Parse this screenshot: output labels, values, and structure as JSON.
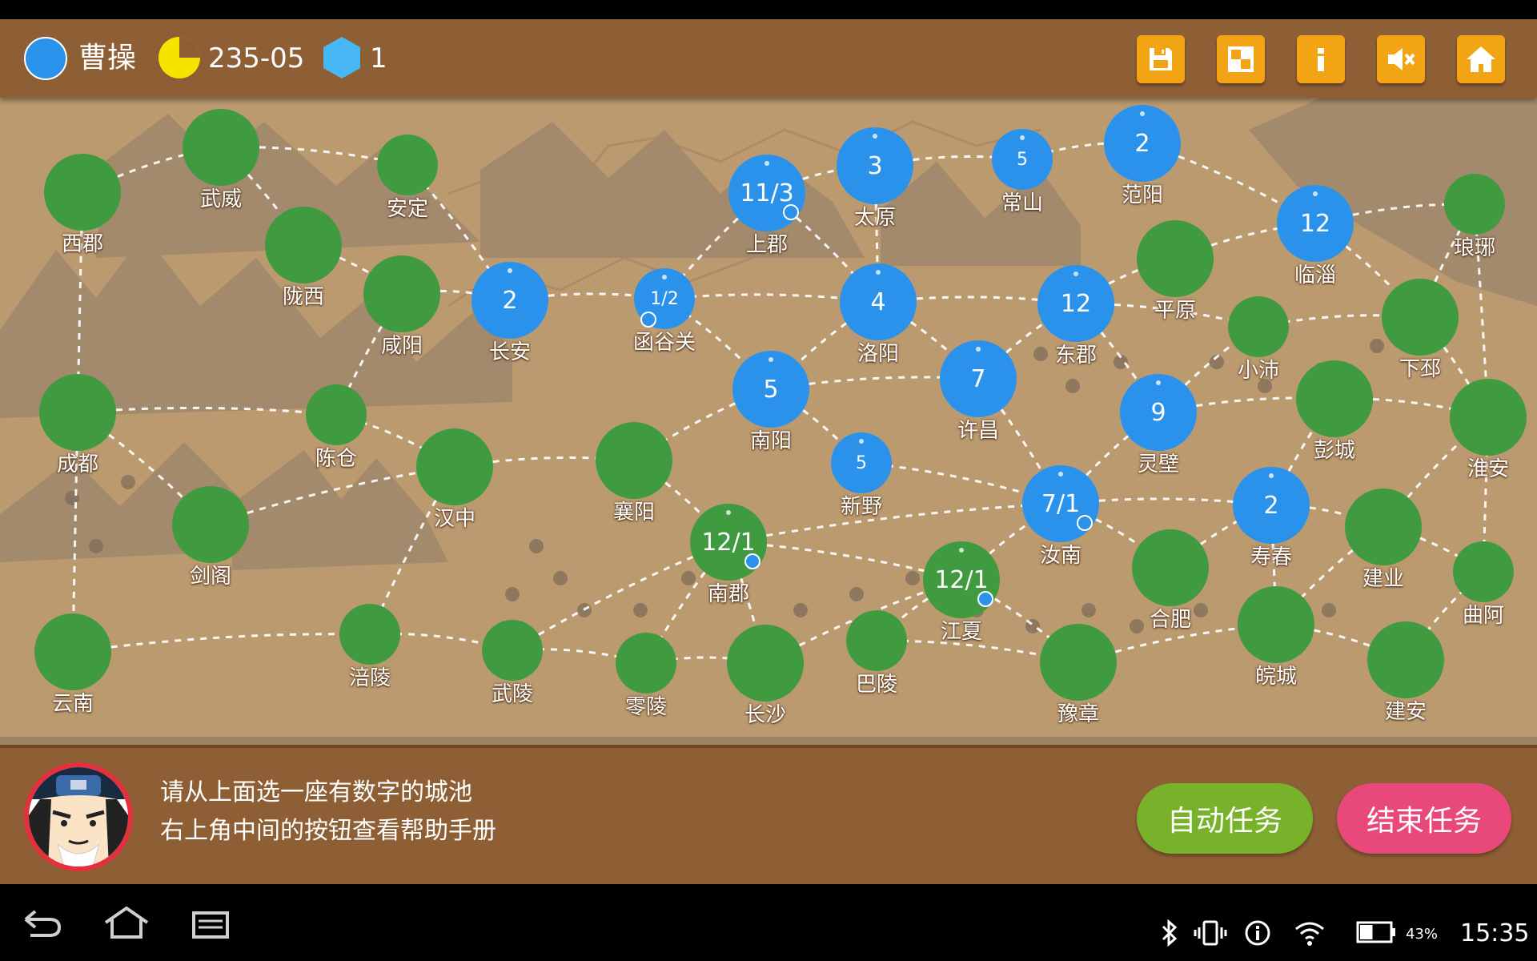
{
  "header": {
    "player_name": "曹操",
    "turn": "235-05",
    "gems": "1",
    "buttons": [
      {
        "name": "save-button",
        "icon": "save-icon"
      },
      {
        "name": "overview-button",
        "icon": "grid-icon"
      },
      {
        "name": "info-button",
        "icon": "info-icon"
      },
      {
        "name": "mute-button",
        "icon": "speaker-mute-icon"
      },
      {
        "name": "home-button",
        "icon": "home-icon"
      }
    ],
    "colors": {
      "bar": "#8e5f35",
      "button": "#f2a414",
      "player": "#2b92ec",
      "turn_pie": "#f5e300",
      "gem": "#48b8f4"
    }
  },
  "map": {
    "colors": {
      "own_city": "#2b92ec",
      "enemy_city": "#3f9a40",
      "terrain": "#bc9a70"
    },
    "cities": [
      {
        "name": "西郡",
        "side": "enemy",
        "value": ""
      },
      {
        "name": "武威",
        "side": "enemy",
        "value": ""
      },
      {
        "name": "安定",
        "side": "enemy",
        "value": ""
      },
      {
        "name": "陇西",
        "side": "enemy",
        "value": ""
      },
      {
        "name": "咸阳",
        "side": "enemy",
        "value": ""
      },
      {
        "name": "长安",
        "side": "own",
        "value": "2"
      },
      {
        "name": "函谷关",
        "side": "own",
        "value": "1/2"
      },
      {
        "name": "上郡",
        "side": "own",
        "value": "11/3"
      },
      {
        "name": "太原",
        "side": "own",
        "value": "3"
      },
      {
        "name": "常山",
        "side": "own",
        "value": "5"
      },
      {
        "name": "范阳",
        "side": "own",
        "value": "2"
      },
      {
        "name": "临淄",
        "side": "own",
        "value": "12"
      },
      {
        "name": "琅琊",
        "side": "enemy",
        "value": ""
      },
      {
        "name": "洛阳",
        "side": "own",
        "value": "4"
      },
      {
        "name": "东郡",
        "side": "own",
        "value": "12"
      },
      {
        "name": "平原",
        "side": "enemy",
        "value": ""
      },
      {
        "name": "小沛",
        "side": "enemy",
        "value": ""
      },
      {
        "name": "下邳",
        "side": "enemy",
        "value": ""
      },
      {
        "name": "成都",
        "side": "enemy",
        "value": ""
      },
      {
        "name": "陈仓",
        "side": "enemy",
        "value": ""
      },
      {
        "name": "南阳",
        "side": "own",
        "value": "5"
      },
      {
        "name": "许昌",
        "side": "own",
        "value": "7"
      },
      {
        "name": "灵壁",
        "side": "own",
        "value": "9"
      },
      {
        "name": "彭城",
        "side": "enemy",
        "value": ""
      },
      {
        "name": "淮安",
        "side": "enemy",
        "value": ""
      },
      {
        "name": "汉中",
        "side": "enemy",
        "value": ""
      },
      {
        "name": "襄阳",
        "side": "enemy",
        "value": ""
      },
      {
        "name": "新野",
        "side": "own",
        "value": "5"
      },
      {
        "name": "剑阁",
        "side": "enemy",
        "value": ""
      },
      {
        "name": "汝南",
        "side": "own",
        "value": "7/1"
      },
      {
        "name": "寿春",
        "side": "own",
        "value": "2"
      },
      {
        "name": "建业",
        "side": "enemy",
        "value": ""
      },
      {
        "name": "南郡",
        "side": "enemy",
        "value": "12/1"
      },
      {
        "name": "江夏",
        "side": "enemy",
        "value": "12/1"
      },
      {
        "name": "合肥",
        "side": "enemy",
        "value": ""
      },
      {
        "name": "曲阿",
        "side": "enemy",
        "value": ""
      },
      {
        "name": "云南",
        "side": "enemy",
        "value": ""
      },
      {
        "name": "涪陵",
        "side": "enemy",
        "value": ""
      },
      {
        "name": "武陵",
        "side": "enemy",
        "value": ""
      },
      {
        "name": "零陵",
        "side": "enemy",
        "value": ""
      },
      {
        "name": "长沙",
        "side": "enemy",
        "value": ""
      },
      {
        "name": "巴陵",
        "side": "enemy",
        "value": ""
      },
      {
        "name": "豫章",
        "side": "enemy",
        "value": ""
      },
      {
        "name": "皖城",
        "side": "enemy",
        "value": ""
      },
      {
        "name": "建安",
        "side": "enemy",
        "value": ""
      }
    ]
  },
  "bottom": {
    "message_line1": "请从上面选一座有数字的城池",
    "message_line2": "右上角中间的按钮查看帮助手册",
    "auto_button": "自动任务",
    "end_button": "结束任务",
    "colors": {
      "auto": "#78b22a",
      "end": "#e8487a",
      "advisor_ring": "#e62f3d"
    }
  },
  "system": {
    "battery": "43%",
    "clock": "15:35"
  }
}
